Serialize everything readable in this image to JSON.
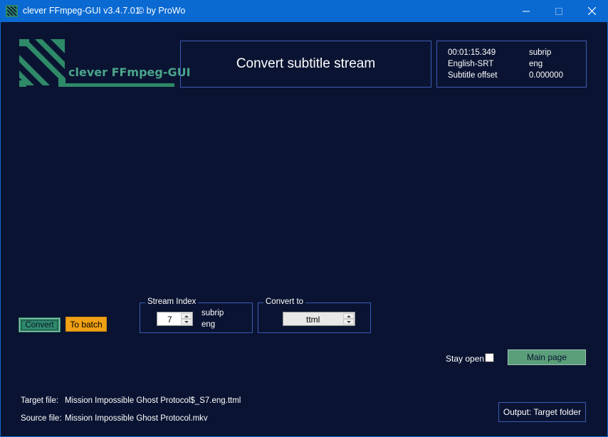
{
  "window": {
    "title": "clever FFmpeg-GUI v3.4.7.01",
    "copyright": "© by ProWo",
    "controls": {
      "minimize": "minimize-icon",
      "maximize": "maximize-icon",
      "close": "close-icon"
    }
  },
  "logo": {
    "text": "clever FFmpeg-GUI"
  },
  "header": {
    "title": "Convert subtitle stream"
  },
  "stream_info": {
    "duration": "00:01:15.349",
    "codec": "subrip",
    "name": "English-SRT",
    "language": "eng",
    "offset_label": "Subtitle offset",
    "offset_value": "0.000000"
  },
  "actions": {
    "convert": "Convert",
    "to_batch": "To batch"
  },
  "stream_index": {
    "legend": "Stream Index",
    "value": "7",
    "codec": "subrip",
    "language": "eng"
  },
  "convert_to": {
    "legend": "Convert to",
    "value": "ttml"
  },
  "stay_open": {
    "label": "Stay open",
    "checked": false
  },
  "main_page": {
    "label": "Main page"
  },
  "files": {
    "target_label": "Target file:",
    "target_value": "Mission Impossible Ghost Protocol$_S7.eng.ttml",
    "source_label": "Source file:",
    "source_value": "Mission Impossible Ghost Protocol.mkv"
  },
  "output": {
    "label": "Output: Target folder"
  },
  "colors": {
    "background": "#0a1432",
    "titlebar": "#0a6ad2",
    "accent_green": "#2e8a68",
    "accent_orange": "#f0a014",
    "border": "#3c5ab4"
  }
}
